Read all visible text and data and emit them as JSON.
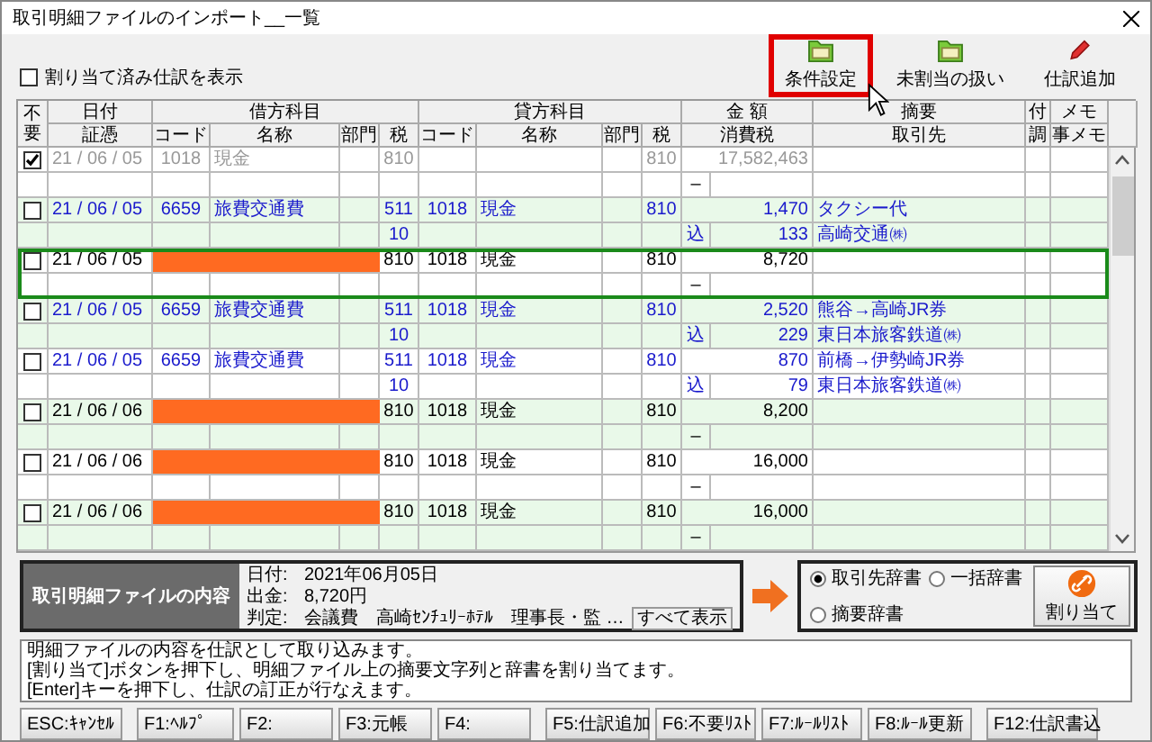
{
  "window": {
    "title": "取引明細ファイルのインポート__一覧"
  },
  "toolbar": {
    "show_assigned": {
      "label": "割り当て済み仕訳を表示",
      "checked": false
    },
    "buttons": [
      {
        "label": "条件設定",
        "kind": "folder",
        "highlighted": true
      },
      {
        "label": "未割当の扱い",
        "kind": "folder",
        "highlighted": false
      },
      {
        "label": "仕訳追加",
        "kind": "pencil",
        "highlighted": false
      }
    ]
  },
  "table": {
    "columns_top": [
      "不要",
      "日付",
      "借方科目",
      "貸方科目",
      "金 額",
      "摘要",
      "付",
      "メモ"
    ],
    "columns_bottom": [
      "証憑",
      "コード",
      "名称",
      "部門",
      "税",
      "コード",
      "名称",
      "部門",
      "税",
      "消費税",
      "取引先",
      "調",
      "事メモ"
    ],
    "rows": [
      {
        "kind": "registered",
        "excluded": true,
        "selected": false,
        "redacted": false,
        "date": "21 / 06 / 05",
        "debit_code": "1018",
        "debit_name": "現金",
        "debit_tax": "810",
        "credit_tax": "810",
        "amount": "17,582,463",
        "tax_mark": "–"
      },
      {
        "kind": "assigned",
        "excluded": false,
        "selected": false,
        "redacted": false,
        "date": "21 / 06 / 05",
        "debit_code": "6659",
        "debit_name": "旅費交通費",
        "debit_tax": "511",
        "debit_tax_rate": "10",
        "credit_code": "1018",
        "credit_name": "現金",
        "credit_tax": "810",
        "amount": "1,470",
        "tax_mark": "込",
        "tax_amount": "133",
        "summary": "タクシー代",
        "partner": "高崎交通㈱"
      },
      {
        "kind": "unassigned",
        "excluded": false,
        "selected": true,
        "redacted": true,
        "date": "21 / 06 / 05",
        "debit_tax": "810",
        "credit_code": "1018",
        "credit_name": "現金",
        "credit_tax": "810",
        "amount": "8,720",
        "tax_mark": "–"
      },
      {
        "kind": "assigned",
        "excluded": false,
        "selected": false,
        "redacted": false,
        "date": "21 / 06 / 05",
        "debit_code": "6659",
        "debit_name": "旅費交通費",
        "debit_tax": "511",
        "debit_tax_rate": "10",
        "credit_code": "1018",
        "credit_name": "現金",
        "credit_tax": "810",
        "amount": "2,520",
        "tax_mark": "込",
        "tax_amount": "229",
        "summary": "熊谷→高崎JR券",
        "partner": "東日本旅客鉄道㈱"
      },
      {
        "kind": "assigned",
        "excluded": false,
        "selected": false,
        "redacted": false,
        "date": "21 / 06 / 05",
        "debit_code": "6659",
        "debit_name": "旅費交通費",
        "debit_tax": "511",
        "debit_tax_rate": "10",
        "credit_code": "1018",
        "credit_name": "現金",
        "credit_tax": "810",
        "amount": "870",
        "tax_mark": "込",
        "tax_amount": "79",
        "summary": "前橋→伊勢崎JR券",
        "partner": "東日本旅客鉄道㈱"
      },
      {
        "kind": "unassigned",
        "excluded": false,
        "selected": false,
        "redacted": true,
        "date": "21 / 06 / 06",
        "debit_tax": "810",
        "credit_code": "1018",
        "credit_name": "現金",
        "credit_tax": "810",
        "amount": "8,200",
        "tax_mark": "–"
      },
      {
        "kind": "unassigned",
        "excluded": false,
        "selected": false,
        "redacted": true,
        "date": "21 / 06 / 06",
        "debit_tax": "810",
        "credit_code": "1018",
        "credit_name": "現金",
        "credit_tax": "810",
        "amount": "16,000",
        "tax_mark": "–"
      },
      {
        "kind": "unassigned",
        "excluded": false,
        "selected": false,
        "redacted": true,
        "date": "21 / 06 / 06",
        "debit_tax": "810",
        "credit_code": "1018",
        "credit_name": "現金",
        "credit_tax": "810",
        "amount": "16,000",
        "tax_mark": "–"
      }
    ]
  },
  "detail": {
    "heading": "取引明細ファイルの内容",
    "fields": [
      {
        "label": "日付:",
        "value": "2021年06月05日"
      },
      {
        "label": "出金:",
        "value": "8,720円"
      },
      {
        "label": "判定:",
        "value": "会議費　高崎ｾﾝﾁｭﾘｰﾎﾃﾙ　理事長・監 …"
      }
    ],
    "show_all": "すべて表示"
  },
  "dictionary": {
    "options": [
      {
        "label": "取引先辞書",
        "selected": true
      },
      {
        "label": "一括辞書",
        "selected": false
      },
      {
        "label": "摘要辞書",
        "selected": false
      }
    ],
    "assign_button": "割り当て"
  },
  "message": [
    "明細ファイルの内容を仕訳として取り込みます。",
    "[割り当て]ボタンを押下し、明細ファイル上の摘要文字列と辞書を割り当てます。",
    "[Enter]キーを押下し、仕訳の訂正が行なえます。"
  ],
  "function_keys": [
    "ESC:ｷｬﾝｾﾙ",
    "F1:ﾍﾙﾌﾟ",
    "F2:",
    "F3:元帳",
    "F4:",
    "F5:仕訳追加",
    "F6:不要ﾘｽﾄ",
    "F7:ﾙｰﾙﾘｽﾄ",
    "F8:ﾙｰﾙ更新",
    "F12:仕訳書込"
  ]
}
